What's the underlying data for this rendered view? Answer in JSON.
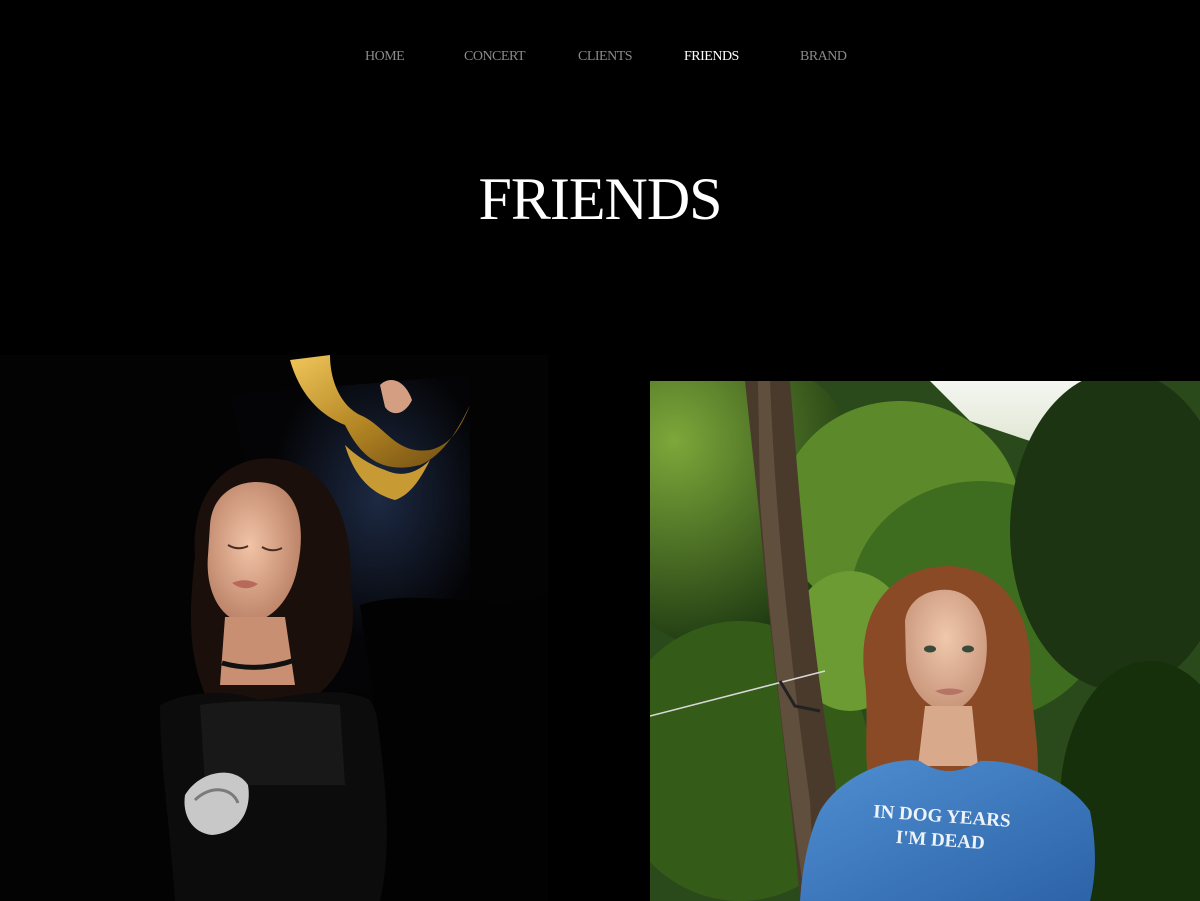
{
  "nav": {
    "items": [
      {
        "label": "HOME",
        "active": false
      },
      {
        "label": "CONCERT",
        "active": false
      },
      {
        "label": "CLIENTS",
        "active": false
      },
      {
        "label": "FRIENDS",
        "active": true
      },
      {
        "label": "BRAND",
        "active": false
      }
    ]
  },
  "page": {
    "title": "FRIENDS"
  },
  "gallery": {
    "photo_2": {
      "shirt_line_1": "IN DOG YEARS",
      "shirt_line_2": "I'M DEAD"
    }
  },
  "colors": {
    "background": "#000000",
    "nav_inactive": "#8a8a8a",
    "nav_active": "#ffffff",
    "title": "#ffffff"
  }
}
